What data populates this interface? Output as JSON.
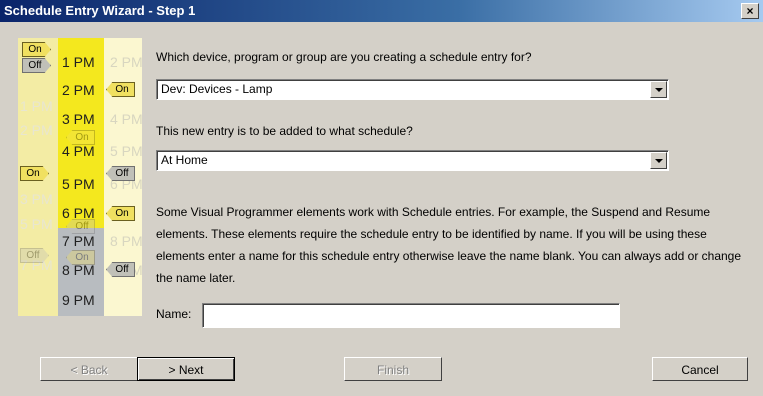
{
  "window": {
    "title": "Schedule Entry Wizard - Step 1",
    "close_glyph": "×"
  },
  "graphic": {
    "times_a": [
      "1 PM",
      "2 PM",
      "3 PM",
      "5 PM",
      "7 PM"
    ],
    "times_b": [
      "1 PM",
      "2 PM",
      "3 PM",
      "4 PM",
      "5 PM",
      "6 PM",
      "7 PM",
      "8 PM",
      "9 PM"
    ],
    "times_c": [
      "2 PM",
      "4 PM",
      "5 PM",
      "6 PM",
      "8 PM",
      "9 PM"
    ],
    "tag_on": "On",
    "tag_off": "Off"
  },
  "device": {
    "label": "Which device, program or group are you creating a schedule entry for?",
    "value": "Dev: Devices - Lamp"
  },
  "schedule": {
    "label": "This new entry is to be added to what schedule?",
    "value": "At Home"
  },
  "info_text": "Some Visual Programmer elements work with Schedule entries.  For example, the Suspend and Resume elements.  These elements require the schedule entry to be identified by name.  If you will be using these elements enter a name for this schedule entry otherwise leave the name blank.  You can always add or change the name later.",
  "name_field": {
    "label": "Name:",
    "value": ""
  },
  "buttons": {
    "back": "< Back",
    "next": "> Next",
    "finish": "Finish",
    "cancel": "Cancel"
  }
}
